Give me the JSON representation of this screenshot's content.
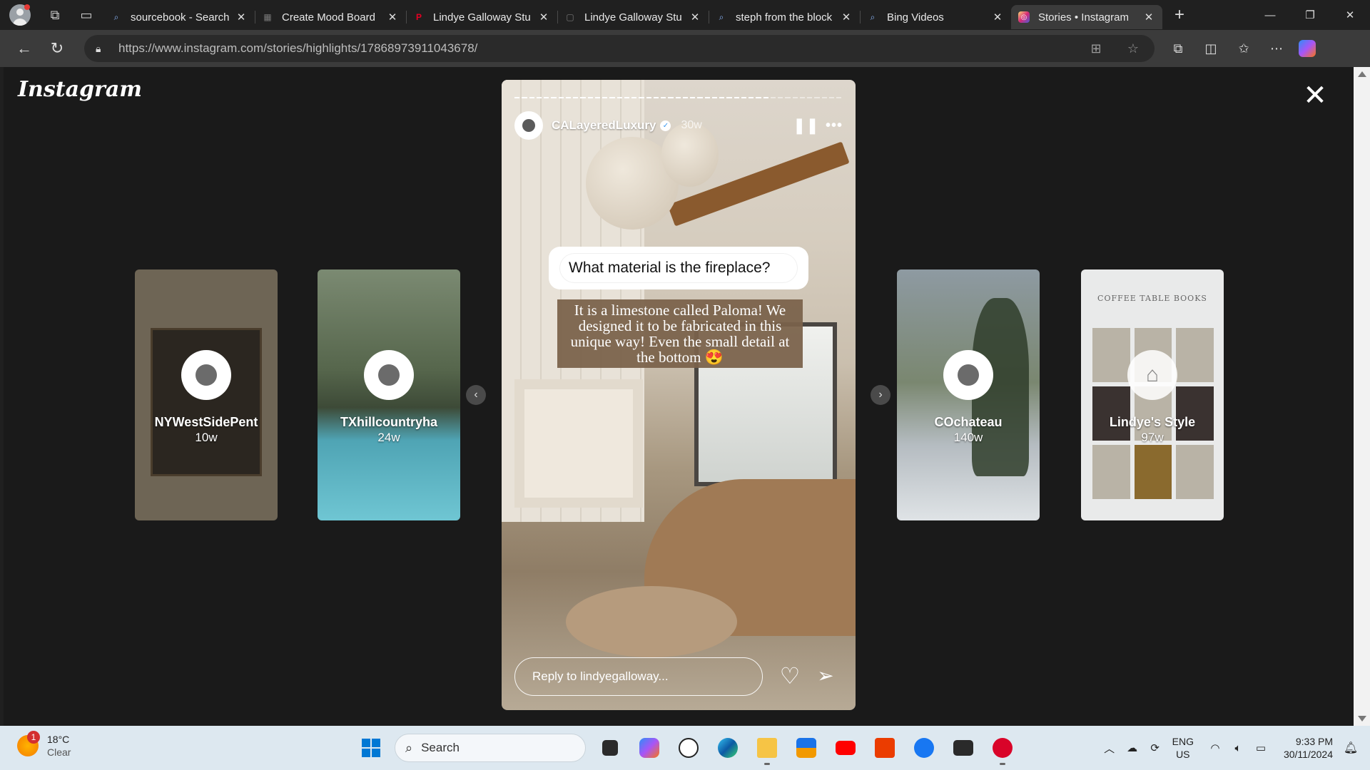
{
  "browser": {
    "tabs": [
      {
        "title": "sourcebook - Search",
        "icon": "search-icon",
        "active": false
      },
      {
        "title": "Create Mood Board",
        "icon": "moodboard-icon",
        "active": false
      },
      {
        "title": "Lindye Galloway Stu",
        "icon": "pinterest-icon",
        "active": false
      },
      {
        "title": "Lindye Galloway Stu",
        "icon": "page-icon",
        "active": false
      },
      {
        "title": "steph from the block",
        "icon": "search-icon",
        "active": false
      },
      {
        "title": "Bing Videos",
        "icon": "search-icon",
        "active": false
      },
      {
        "title": "Stories • Instagram",
        "icon": "instagram-icon",
        "active": true
      }
    ],
    "url": "https://www.instagram.com/stories/highlights/17868973911043678/"
  },
  "instagram": {
    "logo": "Instagram",
    "side_stories_left": [
      {
        "username": "NYWestSidePent",
        "age": "10w"
      },
      {
        "username": "TXhillcountryha",
        "age": "24w"
      }
    ],
    "side_stories_right": [
      {
        "username": "COchateau",
        "age": "140w"
      },
      {
        "username": "Lindye's Style",
        "age": "97w",
        "headline": "COFFEE TABLE BOOKS"
      }
    ],
    "story": {
      "username": "CALayeredLuxury",
      "age": "30w",
      "question": "What material is the fireplace?",
      "answer": "It is a limestone called Paloma! We designed it to be fabricated in this unique way! Even the small detail at the bottom 😍",
      "reply_placeholder": "Reply to lindyegalloway...",
      "progress_segments": 45,
      "progress_done": 35
    }
  },
  "taskbar": {
    "weather_temp": "18°C",
    "weather_desc": "Clear",
    "weather_badge": "1",
    "search_placeholder": "Search",
    "lang_1": "ENG",
    "lang_2": "US",
    "time": "9:33 PM",
    "date": "30/11/2024"
  }
}
